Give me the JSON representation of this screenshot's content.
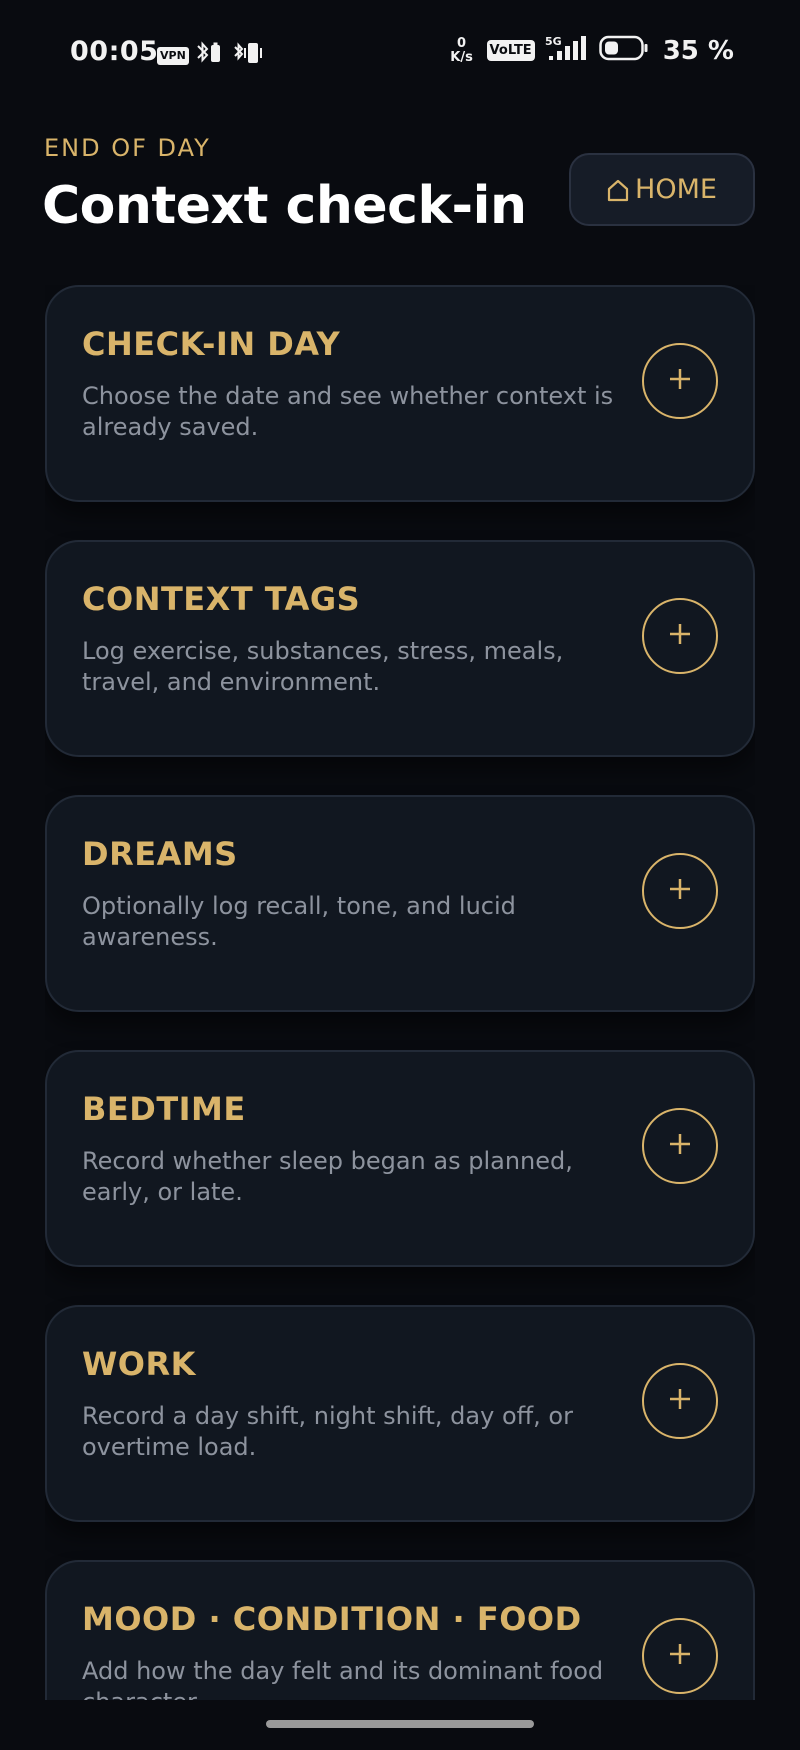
{
  "status_bar": {
    "time": "00:05",
    "vpn": "VPN",
    "net_speed_value": "0",
    "net_speed_unit": "K/s",
    "volte": "VoLTE",
    "network": "5G",
    "battery_percent": "35 %"
  },
  "header": {
    "eyebrow": "END OF DAY",
    "title": "Context check-in",
    "home_button_label": "HOME"
  },
  "cards": [
    {
      "title": "CHECK-IN DAY",
      "description": "Choose the date and see whether context is already saved."
    },
    {
      "title": "CONTEXT TAGS",
      "description": "Log exercise, substances, stress, meals, travel, and environment."
    },
    {
      "title": "DREAMS",
      "description": "Optionally log recall, tone, and lucid awareness."
    },
    {
      "title": "BEDTIME",
      "description": "Record whether sleep began as planned, early, or late."
    },
    {
      "title": "WORK",
      "description": "Record a day shift, night shift, day off, or overtime load."
    },
    {
      "title": "MOOD · CONDITION · FOOD",
      "description": "Add how the day felt and its dominant food character."
    }
  ],
  "colors": {
    "background": "#090b10",
    "card": "#111720",
    "accent_gold": "#d9b46a",
    "muted_text": "#8d939e"
  },
  "icons": {
    "home": "home-icon",
    "add": "plus-circle-icon"
  }
}
